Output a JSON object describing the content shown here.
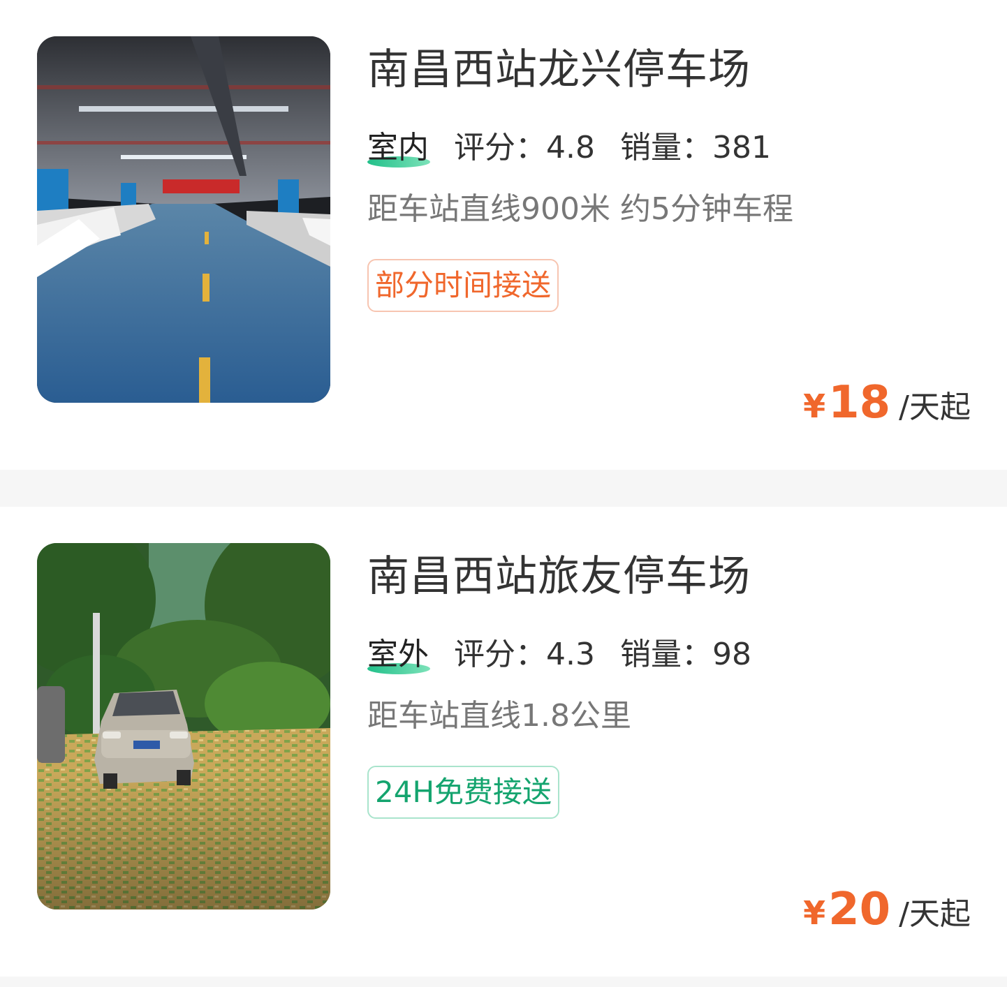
{
  "listings": [
    {
      "title": "南昌西站龙兴停车场",
      "environment": "室内",
      "rating_label": "评分：",
      "rating": "4.8",
      "sales_label": "销量：",
      "sales": "381",
      "distance": "距车站直线900米 约5分钟车程",
      "service_tag": "部分时间接送",
      "service_tag_color": "#f0672c",
      "currency": "¥",
      "price": "18",
      "price_unit": "/天起"
    },
    {
      "title": "南昌西站旅友停车场",
      "environment": "室外",
      "rating_label": "评分：",
      "rating": "4.3",
      "sales_label": "销量：",
      "sales": "98",
      "distance": "距车站直线1.8公里",
      "service_tag": "24H免费接送",
      "service_tag_color": "#14a46e",
      "currency": "¥",
      "price": "20",
      "price_unit": "/天起"
    }
  ],
  "colors": {
    "price": "#f0672c",
    "accent_green": "#22c08a",
    "divider_bg": "#f6f6f6"
  }
}
